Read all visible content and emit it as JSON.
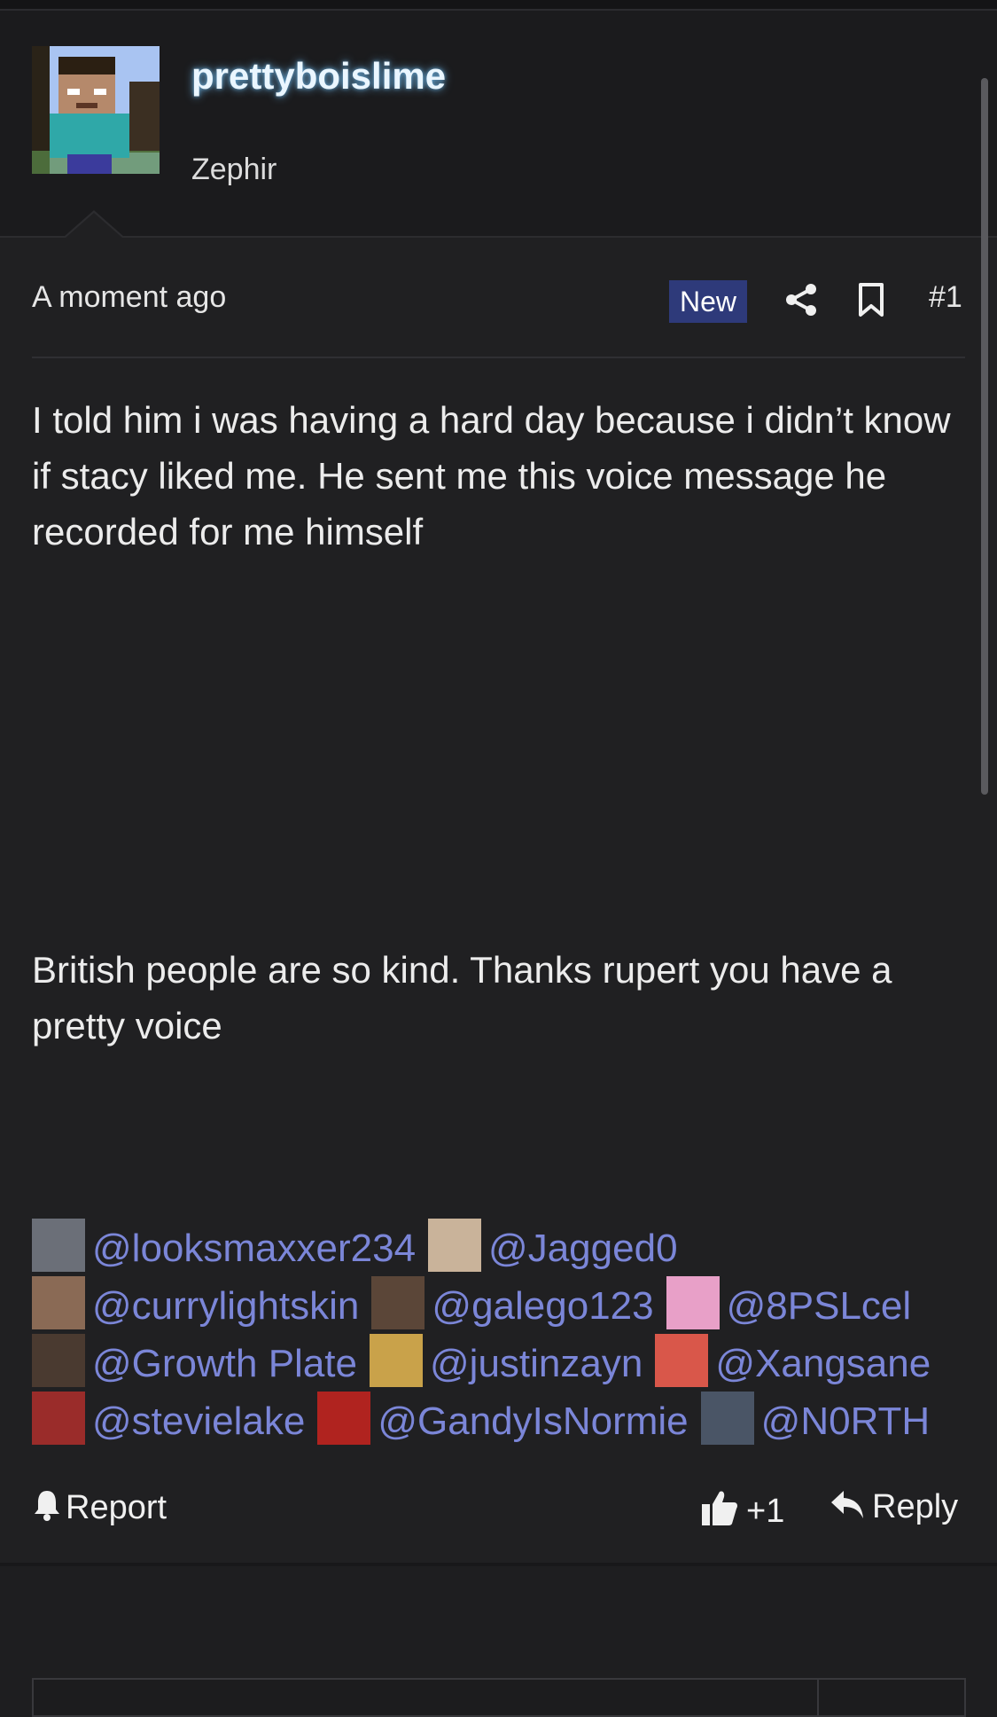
{
  "post": {
    "username": "prettyboislime",
    "user_title": "Zephir",
    "time": "A moment ago",
    "badge": "New",
    "post_number": "#1",
    "paragraph1": "I told him i was having a hard day because i didn’t know if stacy liked me. He sent me this voice message he recorded for me himself",
    "paragraph2": "British people are so kind. Thanks rupert you have a pretty voice"
  },
  "mentions": [
    {
      "handle": "@looksmaxxer234",
      "avatar_color": "#6b6f78"
    },
    {
      "handle": "@Jagged0",
      "avatar_color": "#c9b39a"
    },
    {
      "handle": "@currylightskin",
      "avatar_color": "#8a6a55"
    },
    {
      "handle": "@galego123",
      "avatar_color": "#5b4638"
    },
    {
      "handle": "@8PSLcel",
      "avatar_color": "#e8a0c8"
    },
    {
      "handle": "@Growth Plate",
      "avatar_color": "#4a3a30"
    },
    {
      "handle": "@justinzayn",
      "avatar_color": "#c9a24a"
    },
    {
      "handle": "@Xangsane",
      "avatar_color": "#d9574a"
    },
    {
      "handle": "@stevielake",
      "avatar_color": "#9a2c2a"
    },
    {
      "handle": "@GandyIsNormie",
      "avatar_color": "#b0231f"
    },
    {
      "handle": "@N0RTH",
      "avatar_color": "#4a5566"
    }
  ],
  "actions": {
    "report": "Report",
    "like_count": "+1",
    "reply": "Reply"
  },
  "colors": {
    "background": "#202022",
    "mention": "#7b86d8",
    "badge_bg": "#2e3a7a"
  },
  "icons": [
    "share-icon",
    "bookmark-icon",
    "bell-icon",
    "thumbs-up-icon",
    "reply-icon"
  ]
}
